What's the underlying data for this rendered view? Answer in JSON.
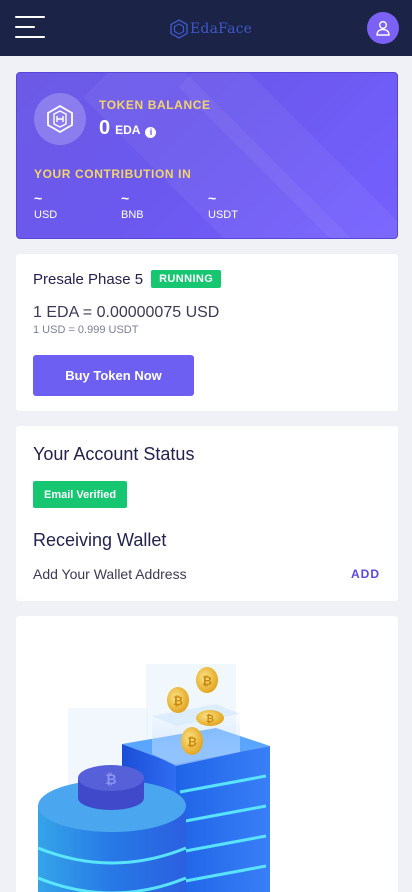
{
  "header": {
    "brand": "EdaFace",
    "menu_icon": "hamburger-menu-icon",
    "profile_icon": "user-icon"
  },
  "balance": {
    "label": "TOKEN BALANCE",
    "amount": "0",
    "unit": "EDA",
    "info_icon": "info-icon",
    "contribution_label": "YOUR CONTRIBUTION IN",
    "contributions": [
      {
        "value": "~",
        "currency": "USD"
      },
      {
        "value": "~",
        "currency": "BNB"
      },
      {
        "value": "~",
        "currency": "USDT"
      }
    ]
  },
  "presale": {
    "title": "Presale Phase 5",
    "status": "RUNNING",
    "rate": "1 EDA = 0.00000075 USD",
    "sub_rate": "1 USD = 0.999 USDT",
    "button": "Buy Token Now"
  },
  "account": {
    "title": "Your Account Status",
    "email_badge": "Email Verified",
    "wallet_title": "Receiving Wallet",
    "wallet_prompt": "Add Your Wallet Address",
    "add_label": "ADD"
  },
  "colors": {
    "topbar": "#1b2347",
    "accent": "#6c5ff2",
    "success": "#17c671",
    "highlight": "#f4d46a"
  }
}
